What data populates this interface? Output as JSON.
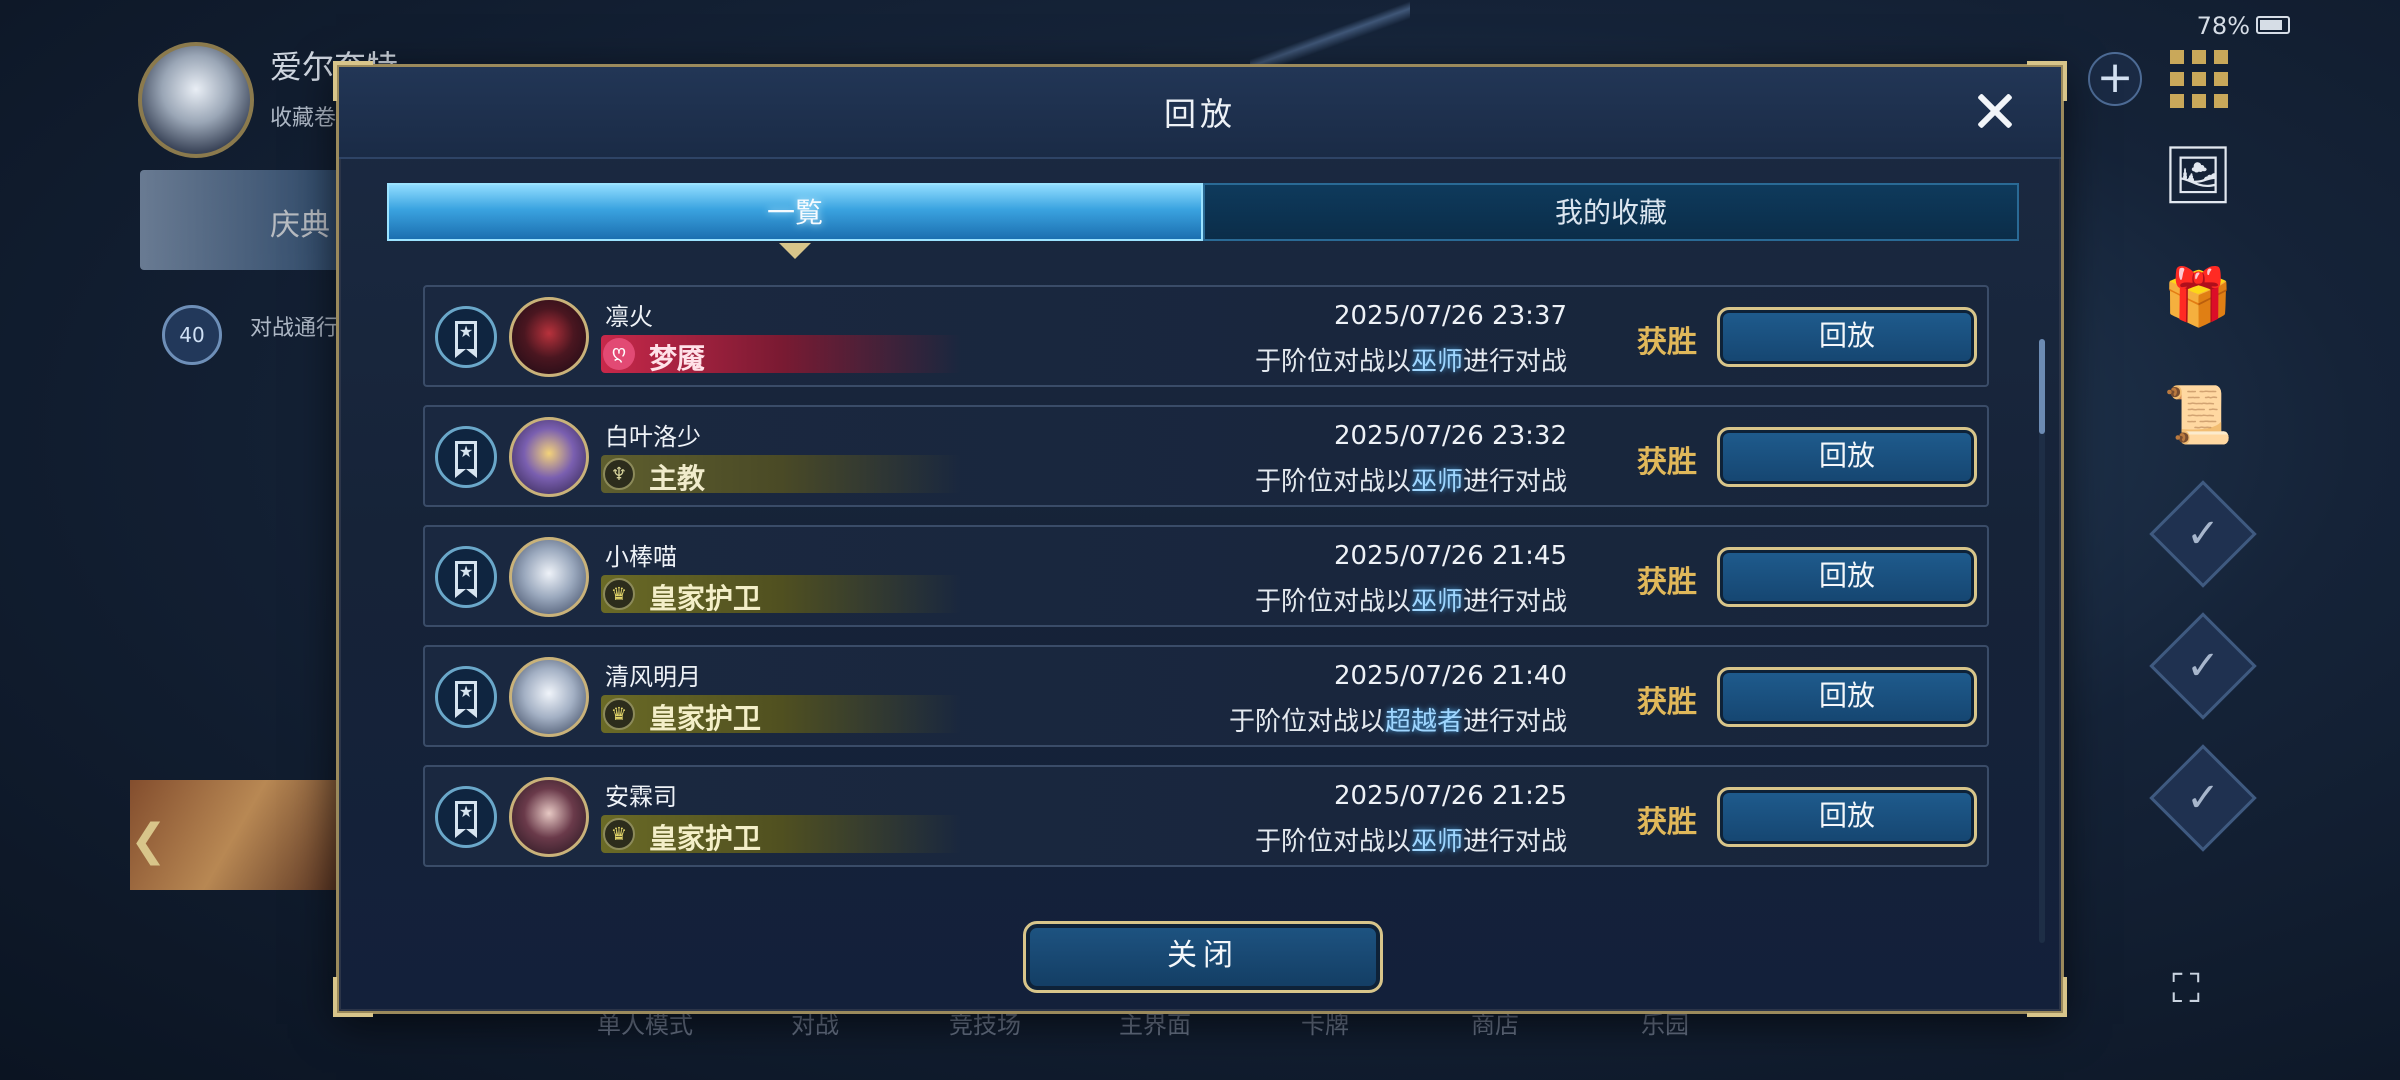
{
  "background": {
    "player_name": "爱尔奎特",
    "player_sub": "收藏卷",
    "banner_text": "庆典",
    "level": "40",
    "pass_label": "对战通行证",
    "battery": "78%",
    "bottom_nav": [
      "单人模式",
      "对战",
      "竞技场",
      "主界面",
      "卡牌",
      "商店",
      "乐园"
    ]
  },
  "dialog": {
    "title": "回放",
    "tabs": [
      {
        "label": "一覧",
        "active": true
      },
      {
        "label": "我的收藏",
        "active": false
      }
    ],
    "rows": [
      {
        "player": "凛火",
        "class_name": "梦魇",
        "class_icon": "ღ",
        "datetime": "2025/07/26  23:37",
        "desc_prefix": "于阶位对战以",
        "desc_class": "巫师",
        "desc_suffix": "进行对战",
        "result": "获胜",
        "button": "回放"
      },
      {
        "player": "白叶洛少",
        "class_name": "主教",
        "class_icon": "♆",
        "datetime": "2025/07/26  23:32",
        "desc_prefix": "于阶位对战以",
        "desc_class": "巫师",
        "desc_suffix": "进行对战",
        "result": "获胜",
        "button": "回放"
      },
      {
        "player": "小棒喵",
        "class_name": "皇家护卫",
        "class_icon": "♛",
        "datetime": "2025/07/26  21:45",
        "desc_prefix": "于阶位对战以",
        "desc_class": "巫师",
        "desc_suffix": "进行对战",
        "result": "获胜",
        "button": "回放"
      },
      {
        "player": "清风明月",
        "class_name": "皇家护卫",
        "class_icon": "♛",
        "datetime": "2025/07/26  21:40",
        "desc_prefix": "于阶位对战以",
        "desc_class": "超越者",
        "desc_suffix": "进行对战",
        "result": "获胜",
        "button": "回放"
      },
      {
        "player": "安霖司",
        "class_name": "皇家护卫",
        "class_icon": "♛",
        "datetime": "2025/07/26  21:25",
        "desc_prefix": "于阶位对战以",
        "desc_class": "巫师",
        "desc_suffix": "进行对战",
        "result": "获胜",
        "button": "回放"
      }
    ],
    "close_label": "关闭"
  },
  "colors": {
    "gold_border": "#d8c58a",
    "result_gold": "#e0b85a",
    "nightmare_red": "#c8284a",
    "havencraft_olive": "#8a8a3a",
    "swordcraft_yellow": "#a8a83c"
  }
}
